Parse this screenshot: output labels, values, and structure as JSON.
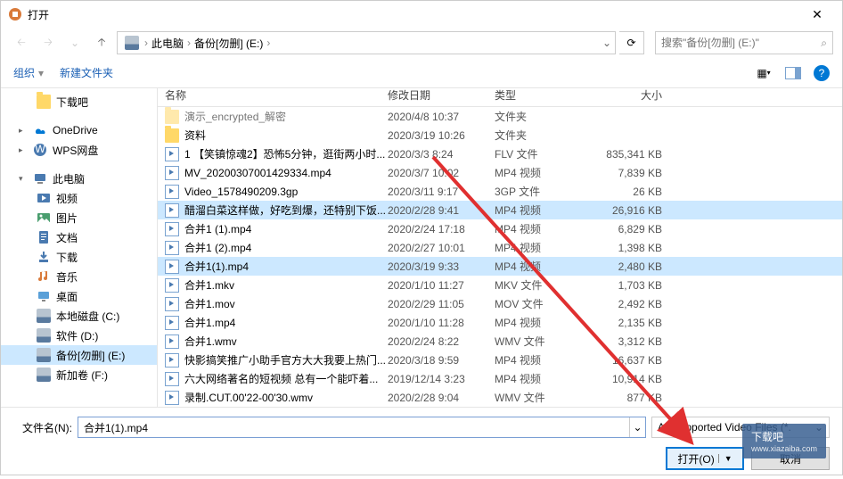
{
  "window": {
    "title": "打开"
  },
  "breadcrumb": {
    "root": "此电脑",
    "folder": "备份[勿删] (E:)"
  },
  "search": {
    "placeholder": "搜索\"备份[勿删] (E:)\""
  },
  "toolbar": {
    "organize": "组织",
    "newfolder": "新建文件夹"
  },
  "columns": {
    "name": "名称",
    "date": "修改日期",
    "type": "类型",
    "size": "大小"
  },
  "sidebar": {
    "items": [
      {
        "label": "下载吧",
        "kind": "folder",
        "indent": 1
      },
      {
        "label": "OneDrive",
        "kind": "onedrive",
        "indent": 0,
        "chevron": "▸"
      },
      {
        "label": "WPS网盘",
        "kind": "wps",
        "indent": 0,
        "chevron": "▸"
      },
      {
        "label": "此电脑",
        "kind": "pc",
        "indent": 0,
        "chevron": "▾"
      },
      {
        "label": "视频",
        "kind": "video",
        "indent": 1
      },
      {
        "label": "图片",
        "kind": "pictures",
        "indent": 1
      },
      {
        "label": "文档",
        "kind": "docs",
        "indent": 1
      },
      {
        "label": "下载",
        "kind": "downloads",
        "indent": 1
      },
      {
        "label": "音乐",
        "kind": "music",
        "indent": 1
      },
      {
        "label": "桌面",
        "kind": "desktop",
        "indent": 1
      },
      {
        "label": "本地磁盘 (C:)",
        "kind": "drive",
        "indent": 1
      },
      {
        "label": "软件 (D:)",
        "kind": "drive",
        "indent": 1
      },
      {
        "label": "备份[勿删] (E:)",
        "kind": "drive",
        "indent": 1,
        "selected": true
      },
      {
        "label": "新加卷 (F:)",
        "kind": "drive",
        "indent": 1
      }
    ]
  },
  "files": [
    {
      "name": "演示_encrypted_解密",
      "date": "2020/4/8 10:37",
      "type": "文件夹",
      "size": "",
      "icon": "folder",
      "cut": true
    },
    {
      "name": "资料",
      "date": "2020/3/19 10:26",
      "type": "文件夹",
      "size": "",
      "icon": "folder"
    },
    {
      "name": "1 【笑镇惊魂2】恐怖5分钟，逛街两小时...",
      "date": "2020/3/3 8:24",
      "type": "FLV 文件",
      "size": "835,341 KB",
      "icon": "video"
    },
    {
      "name": "MV_20200307001429334.mp4",
      "date": "2020/3/7 10:02",
      "type": "MP4 视频",
      "size": "7,839 KB",
      "icon": "video"
    },
    {
      "name": "Video_1578490209.3gp",
      "date": "2020/3/11 9:17",
      "type": "3GP 文件",
      "size": "26 KB",
      "icon": "video"
    },
    {
      "name": "醋溜白菜这样做，好吃到爆，还特别下饭...",
      "date": "2020/2/28 9:41",
      "type": "MP4 视频",
      "size": "26,916 KB",
      "icon": "video",
      "selected": true
    },
    {
      "name": "合并1 (1).mp4",
      "date": "2020/2/24 17:18",
      "type": "MP4 视频",
      "size": "6,829 KB",
      "icon": "video"
    },
    {
      "name": "合并1 (2).mp4",
      "date": "2020/2/27 10:01",
      "type": "MP4 视频",
      "size": "1,398 KB",
      "icon": "video"
    },
    {
      "name": "合并1(1).mp4",
      "date": "2020/3/19 9:33",
      "type": "MP4 视频",
      "size": "2,480 KB",
      "icon": "video",
      "selected": true
    },
    {
      "name": "合并1.mkv",
      "date": "2020/1/10 11:27",
      "type": "MKV 文件",
      "size": "1,703 KB",
      "icon": "video"
    },
    {
      "name": "合并1.mov",
      "date": "2020/2/29 11:05",
      "type": "MOV 文件",
      "size": "2,492 KB",
      "icon": "video"
    },
    {
      "name": "合并1.mp4",
      "date": "2020/1/10 11:28",
      "type": "MP4 视频",
      "size": "2,135 KB",
      "icon": "video"
    },
    {
      "name": "合并1.wmv",
      "date": "2020/2/24 8:22",
      "type": "WMV 文件",
      "size": "3,312 KB",
      "icon": "video"
    },
    {
      "name": "快影搞笑推广小助手官方大大我要上热门...",
      "date": "2020/3/18 9:59",
      "type": "MP4 视频",
      "size": "16,637 KB",
      "icon": "video"
    },
    {
      "name": "六大网络著名的短视频 总有一个能吓着...",
      "date": "2019/12/14 3:23",
      "type": "MP4 视频",
      "size": "10,914 KB",
      "icon": "video"
    },
    {
      "name": "录制.CUT.00'22-00'30.wmv",
      "date": "2020/2/28 9:04",
      "type": "WMV 文件",
      "size": "877 KB",
      "icon": "video"
    }
  ],
  "bottom": {
    "filename_label": "文件名(N):",
    "filename_value": "合并1(1).mp4",
    "filter": "All Supported Video Files (*.",
    "open": "打开(O)",
    "cancel": "取消"
  },
  "watermark": {
    "line1": "下载吧",
    "line2": "www.xiazaiba.com"
  }
}
